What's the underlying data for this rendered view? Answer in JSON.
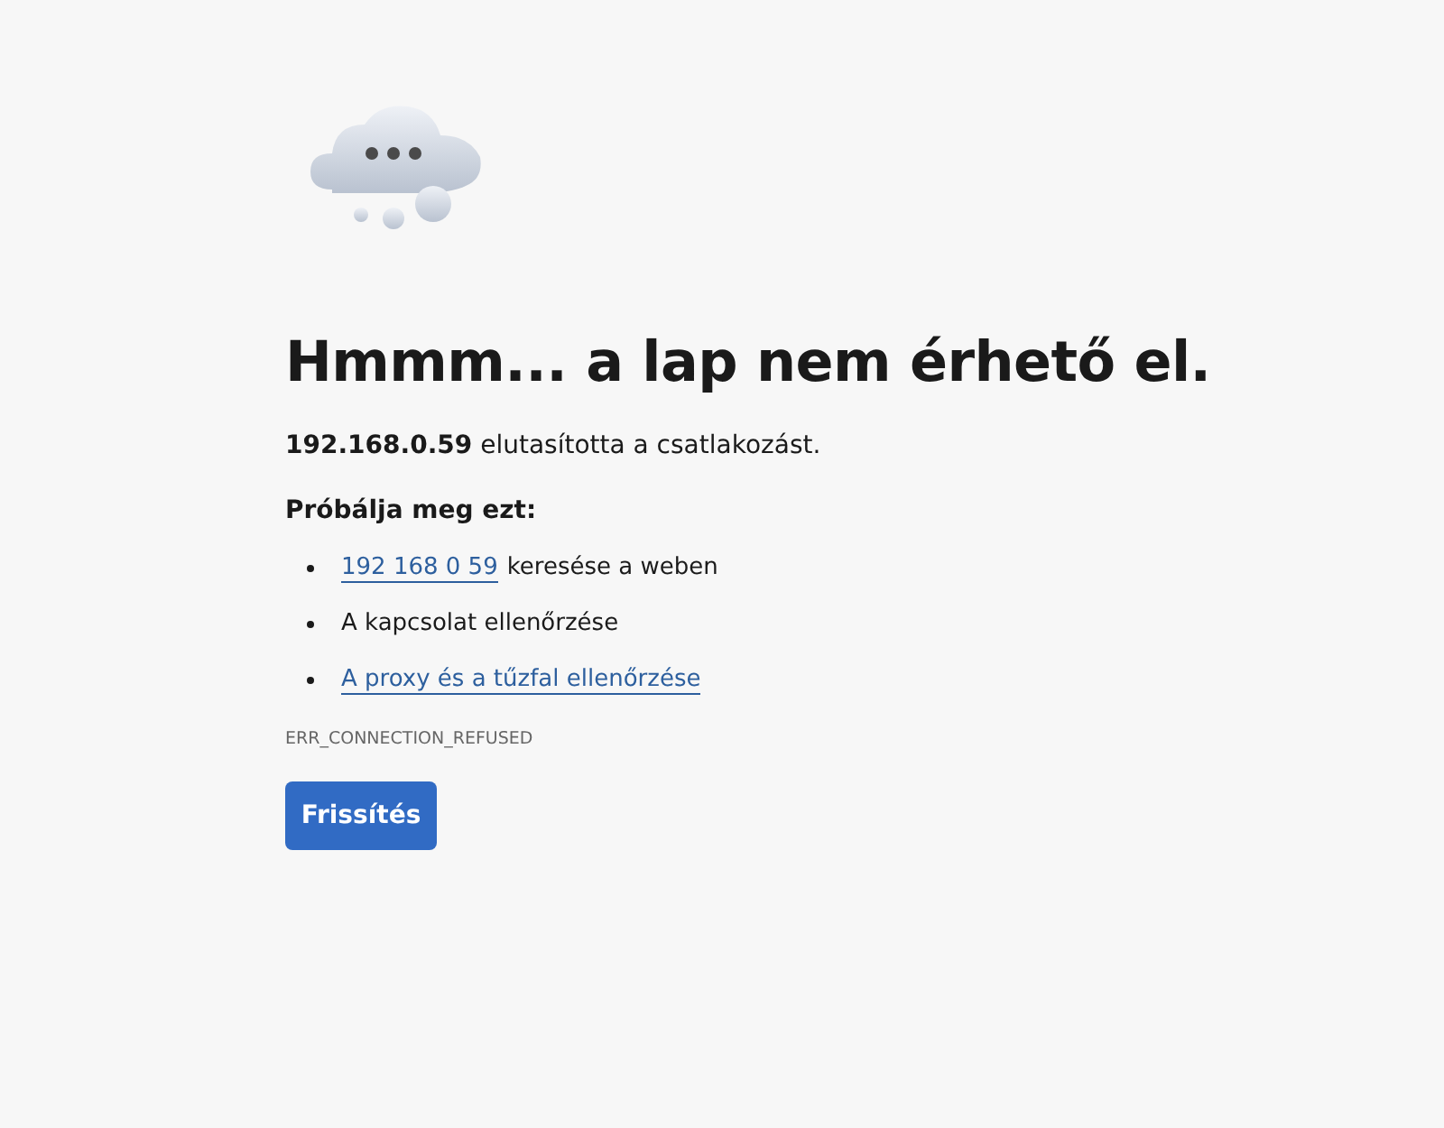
{
  "heading": "Hmmm... a lap nem érhető el.",
  "message": "**192.168.0.59** elutasította a csatlakozást.",
  "suggestions_title": "Próbálja meg ezt:",
  "suggestions": [
    {
      "kind": "link_text",
      "link": "192 168 0 59",
      "text": "keresése a weben"
    },
    {
      "kind": "text",
      "text": "A kapcsolat ellenőrzése"
    },
    {
      "kind": "link",
      "link": "A proxy és a tűzfal ellenőrzése"
    }
  ],
  "error_code": "ERR_CONNECTION_REFUSED",
  "button": "Frissítés"
}
